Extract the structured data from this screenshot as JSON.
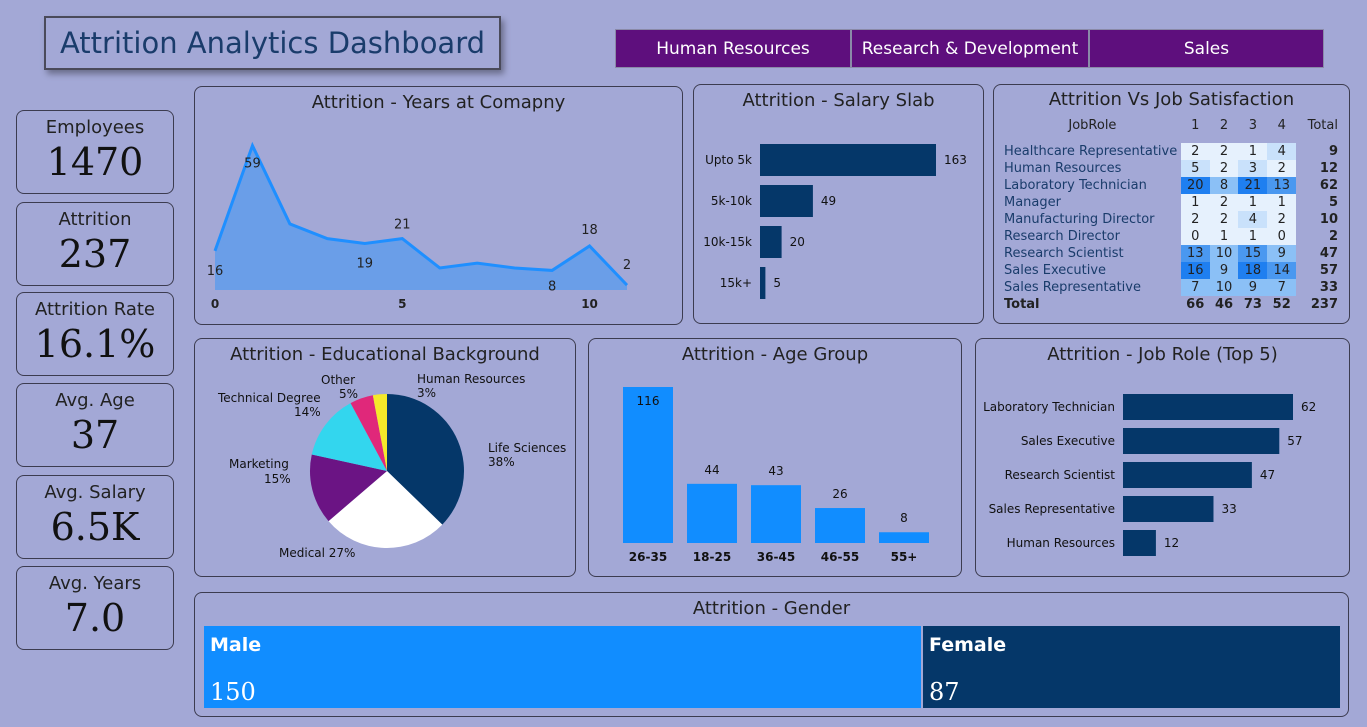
{
  "header": {
    "title": "Attrition Analytics Dashboard"
  },
  "slicers": [
    "Human Resources",
    "Research & Development",
    "Sales"
  ],
  "kpis": [
    {
      "label": "Employees",
      "value": "1470"
    },
    {
      "label": "Attrition",
      "value": "237"
    },
    {
      "label": "Attrition Rate",
      "value": "16.1%"
    },
    {
      "label": "Avg. Age",
      "value": "37"
    },
    {
      "label": "Avg. Salary",
      "value": "6.5K"
    },
    {
      "label": "Avg. Years",
      "value": "7.0"
    }
  ],
  "titles": {
    "years": "Attrition - Years at Comapny",
    "salary": "Attrition - Salary Slab",
    "jobsat": "Attrition Vs Job Satisfaction",
    "education": "Attrition - Educational Background",
    "age": "Attrition - Age Group",
    "jobrole": "Attrition - Job Role (Top 5)",
    "gender": "Attrition - Gender"
  },
  "jobsat": {
    "header": [
      "JobRole",
      "1",
      "2",
      "3",
      "4",
      "Total"
    ],
    "rows": [
      {
        "role": "Healthcare Representative",
        "v": [
          "2",
          "2",
          "1",
          "4"
        ],
        "total": "9"
      },
      {
        "role": "Human Resources",
        "v": [
          "5",
          "2",
          "3",
          "2"
        ],
        "total": "12"
      },
      {
        "role": "Laboratory Technician",
        "v": [
          "20",
          "8",
          "21",
          "13"
        ],
        "total": "62"
      },
      {
        "role": "Manager",
        "v": [
          "1",
          "2",
          "1",
          "1"
        ],
        "total": "5"
      },
      {
        "role": "Manufacturing Director",
        "v": [
          "2",
          "2",
          "4",
          "2"
        ],
        "total": "10"
      },
      {
        "role": "Research Director",
        "v": [
          "0",
          "1",
          "1",
          "0"
        ],
        "total": "2"
      },
      {
        "role": "Research Scientist",
        "v": [
          "13",
          "10",
          "15",
          "9"
        ],
        "total": "47"
      },
      {
        "role": "Sales Executive",
        "v": [
          "16",
          "9",
          "18",
          "14"
        ],
        "total": "57"
      },
      {
        "role": "Sales Representative",
        "v": [
          "7",
          "10",
          "9",
          "7"
        ],
        "total": "33"
      }
    ],
    "total_row": {
      "role": "Total",
      "v": [
        "66",
        "46",
        "73",
        "52"
      ],
      "total": "237"
    }
  },
  "gender": [
    {
      "label": "Male",
      "value": "150"
    },
    {
      "label": "Female",
      "value": "87"
    }
  ],
  "colors": {
    "bar_dark": "#053769",
    "bar_bright": "#118dff",
    "slicer": "#5e0f7d",
    "area": "#6a9ee8",
    "line": "#1f8fff"
  },
  "chart_data": [
    {
      "type": "area",
      "title": "Attrition - Years at Comapny",
      "x": [
        0,
        1,
        2,
        3,
        4,
        5,
        6,
        7,
        8,
        9,
        10,
        11
      ],
      "values": [
        16,
        59,
        27,
        21,
        19,
        21,
        9,
        11,
        9,
        8,
        18,
        2
      ],
      "data_labels": {
        "0": "16",
        "1": "59",
        "4": "19",
        "5": "21",
        "9": "8",
        "10": "18",
        "11": "2"
      },
      "x_ticks": [
        "0",
        "5",
        "10"
      ],
      "ylim": [
        0,
        65
      ]
    },
    {
      "type": "bar",
      "orientation": "horizontal",
      "title": "Attrition - Salary Slab",
      "categories": [
        "Upto 5k",
        "5k-10k",
        "10k-15k",
        "15k+"
      ],
      "values": [
        163,
        49,
        20,
        5
      ]
    },
    {
      "type": "pie",
      "title": "Attrition - Educational Background",
      "categories": [
        "Life Sciences",
        "Medical",
        "Marketing",
        "Technical Degree",
        "Other",
        "Human Resources"
      ],
      "values": [
        38,
        27,
        15,
        14,
        5,
        3
      ],
      "labels": [
        "38%",
        "27%",
        "15%",
        "14%",
        "5%",
        "3%"
      ],
      "colors": [
        "#053769",
        "#ffffff",
        "#6b1484",
        "#33d6ee",
        "#e0287a",
        "#f5e92a"
      ]
    },
    {
      "type": "bar",
      "title": "Attrition - Age Group",
      "categories": [
        "26-35",
        "18-25",
        "36-45",
        "46-55",
        "55+"
      ],
      "values": [
        116,
        44,
        43,
        26,
        8
      ]
    },
    {
      "type": "bar",
      "orientation": "horizontal",
      "title": "Attrition - Job Role (Top 5)",
      "categories": [
        "Laboratory Technician",
        "Sales Executive",
        "Research Scientist",
        "Sales Representative",
        "Human Resources"
      ],
      "values": [
        62,
        57,
        47,
        33,
        12
      ]
    },
    {
      "type": "bar",
      "orientation": "stacked-horizontal",
      "title": "Attrition - Gender",
      "categories": [
        "Male",
        "Female"
      ],
      "values": [
        150,
        87
      ]
    }
  ]
}
